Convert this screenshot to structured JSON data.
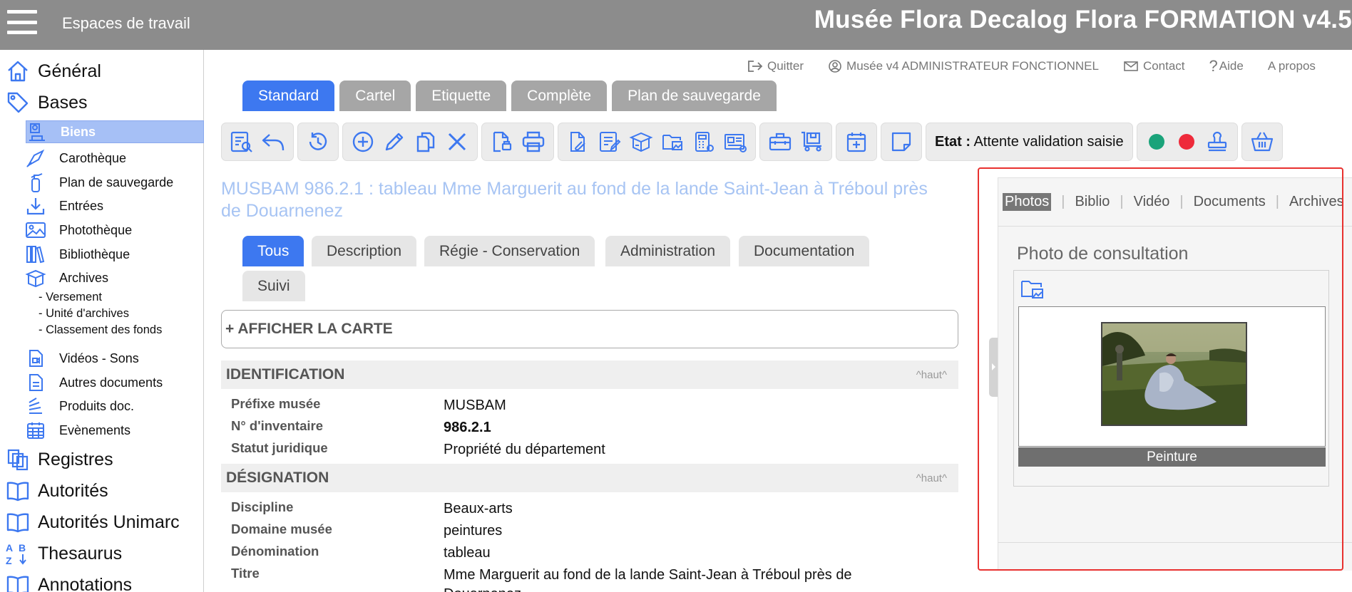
{
  "topbar": {
    "workspaces_label": "Espaces de travail",
    "app_title": "Musée Flora Decalog Flora FORMATION v4.5"
  },
  "sidebar": {
    "top_items": [
      {
        "label": "Général",
        "icon": "home-icon"
      },
      {
        "label": "Bases",
        "icon": "tag-icon"
      },
      {
        "label": "Registres",
        "icon": "registers-icon"
      },
      {
        "label": "Autorités",
        "icon": "book-icon"
      },
      {
        "label": "Autorités Unimarc",
        "icon": "book-icon"
      },
      {
        "label": "Thesaurus",
        "icon": "thesaurus-icon"
      },
      {
        "label": "Annotations",
        "icon": "book-icon"
      }
    ],
    "sub_items": [
      {
        "label": "Biens",
        "icon": "biens-icon",
        "active": true
      },
      {
        "label": "Carothèque",
        "icon": "carotheque-icon"
      },
      {
        "label": "Plan de sauvegarde",
        "icon": "extinguisher-icon"
      },
      {
        "label": "Entrées",
        "icon": "download-icon"
      },
      {
        "label": "Photothèque",
        "icon": "image-icon"
      },
      {
        "label": "Bibliothèque",
        "icon": "library-icon"
      },
      {
        "label": "Archives",
        "icon": "archive-box-icon"
      },
      {
        "label": "Vidéos - Sons",
        "icon": "video-icon"
      },
      {
        "label": "Autres documents",
        "icon": "document-icon"
      },
      {
        "label": "Produits doc.",
        "icon": "stack-icon"
      },
      {
        "label": "Evènements",
        "icon": "calendar-icon"
      }
    ],
    "archive_children": [
      "- Versement",
      "- Unité d'archives",
      "- Classement des fonds"
    ]
  },
  "header_links": [
    {
      "label": "Quitter",
      "icon": "logout-icon"
    },
    {
      "label": "Musée v4 ADMINISTRATEUR FONCTIONNEL",
      "icon": "user-icon"
    },
    {
      "label": "Contact",
      "icon": "mail-icon"
    },
    {
      "label": "Aide",
      "icon": "help-icon"
    },
    {
      "label": "A propos",
      "icon": ""
    }
  ],
  "main_tabs": [
    "Standard",
    "Cartel",
    "Etiquette",
    "Complète",
    "Plan de sauvegarde"
  ],
  "toolbar": {
    "etat_label": "Etat :",
    "etat_value": "Attente validation saisie",
    "status_green": "#1aa37a",
    "status_red": "#ee2a3a",
    "icon_color": "#3d78f0"
  },
  "record_title": "MUSBAM 986.2.1 : tableau Mme Marguerit au fond de la lande Saint-Jean à Tréboul près de Douarnenez",
  "sub_tabs": [
    "Tous",
    "Description",
    "Régie - Conservation",
    "Administration",
    "Documentation",
    "Suivi"
  ],
  "map_toggle": "+ AFFICHER LA CARTE",
  "sections": [
    {
      "title": "IDENTIFICATION",
      "up": "^haut^",
      "fields": [
        {
          "label": "Préfixe musée",
          "value": "MUSBAM"
        },
        {
          "label": "N° d'inventaire",
          "value": "986.2.1"
        },
        {
          "label": "Statut juridique",
          "value": "Propriété du département"
        }
      ]
    },
    {
      "title": "DÉSIGNATION",
      "up": "^haut^",
      "fields": [
        {
          "label": "Discipline",
          "value": "Beaux-arts"
        },
        {
          "label": "Domaine musée",
          "value": "peintures"
        },
        {
          "label": "Dénomination",
          "value": "tableau"
        },
        {
          "label": "Titre",
          "value": "Mme Marguerit au fond de la lande Saint-Jean à Tréboul près de Douarnenez"
        }
      ]
    }
  ],
  "media_panel": {
    "tabs": [
      "Photos",
      "Biblio",
      "Vidéo",
      "Documents",
      "Archives"
    ],
    "heading": "Photo de consultation",
    "caption": "Peinture",
    "highlight_color": "#e8312f"
  }
}
